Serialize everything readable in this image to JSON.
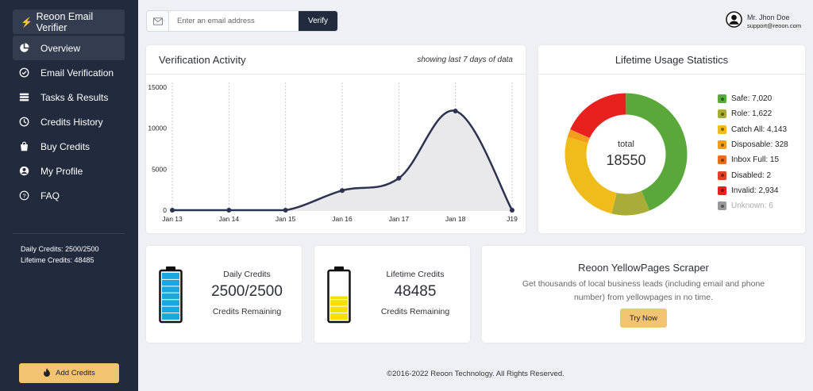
{
  "sidebar": {
    "brand": "Reoon Email Verifier",
    "items": [
      {
        "label": "Overview",
        "icon": "pie-chart-icon"
      },
      {
        "label": "Email Verification",
        "icon": "check-circle-icon"
      },
      {
        "label": "Tasks & Results",
        "icon": "tasks-icon"
      },
      {
        "label": "Credits History",
        "icon": "history-icon"
      },
      {
        "label": "Buy Credits",
        "icon": "shopping-bag-icon"
      },
      {
        "label": "My Profile",
        "icon": "user-circle-icon"
      },
      {
        "label": "FAQ",
        "icon": "question-circle-icon"
      }
    ],
    "daily_credits": "Daily Credits: 2500/2500",
    "lifetime_credits": "Lifetime Credits: 48485",
    "add_credits": "Add Credits"
  },
  "search": {
    "placeholder": "Enter an email address",
    "button": "Verify"
  },
  "user": {
    "name": "Mr. Jhon Doe",
    "email": "support@reoon.com"
  },
  "activity": {
    "title": "Verification Activity",
    "subtitle": "showing last 7 days of data"
  },
  "chart_data": {
    "type": "area",
    "x": [
      "Jan 13",
      "Jan 14",
      "Jan 15",
      "Jan 16",
      "Jan 17",
      "Jan 18",
      "J19"
    ],
    "values": [
      0,
      0,
      0,
      2400,
      3900,
      12100,
      0
    ],
    "yticks": [
      0,
      5000,
      10000,
      15000
    ],
    "ylim": [
      0,
      15000
    ],
    "line_color": "#2b3350",
    "fill_color": "#e9e9ec"
  },
  "stats": {
    "title": "Lifetime Usage Statistics",
    "total_label": "total",
    "total": "18550",
    "legend": [
      {
        "label": "Safe: 7,020",
        "color": "#5aa83c",
        "value": 7020
      },
      {
        "label": "Role: 1,622",
        "color": "#a8ad38",
        "value": 1622
      },
      {
        "label": "Catch All: 4,143",
        "color": "#f0bc1c",
        "value": 4143
      },
      {
        "label": "Disposable: 328",
        "color": "#f59d1b",
        "value": 328
      },
      {
        "label": "Inbox Full: 15",
        "color": "#ec6c1f",
        "value": 15
      },
      {
        "label": "Disabled: 2",
        "color": "#e53e2a",
        "value": 2
      },
      {
        "label": "Invalid: 2,934",
        "color": "#e8211e",
        "value": 2934
      },
      {
        "label": "Unknown: 6",
        "color": "#999999",
        "value": 6
      }
    ]
  },
  "daily_card": {
    "title": "Daily Credits",
    "value": "2500/2500",
    "caption": "Credits Remaining",
    "fill": 1.0,
    "color": "#1aa7e0"
  },
  "lifetime_card": {
    "title": "Lifetime Credits",
    "value": "48485",
    "caption": "Credits Remaining",
    "fill": 0.5,
    "color": "#f5e000"
  },
  "promo": {
    "title": "Reoon YellowPages Scraper",
    "description": "Get thousands of local business leads (including email and phone number) from yellowpages in no time.",
    "button": "Try Now"
  },
  "footer": "©2016-2022 Reoon Technology. All Rights Reserved."
}
